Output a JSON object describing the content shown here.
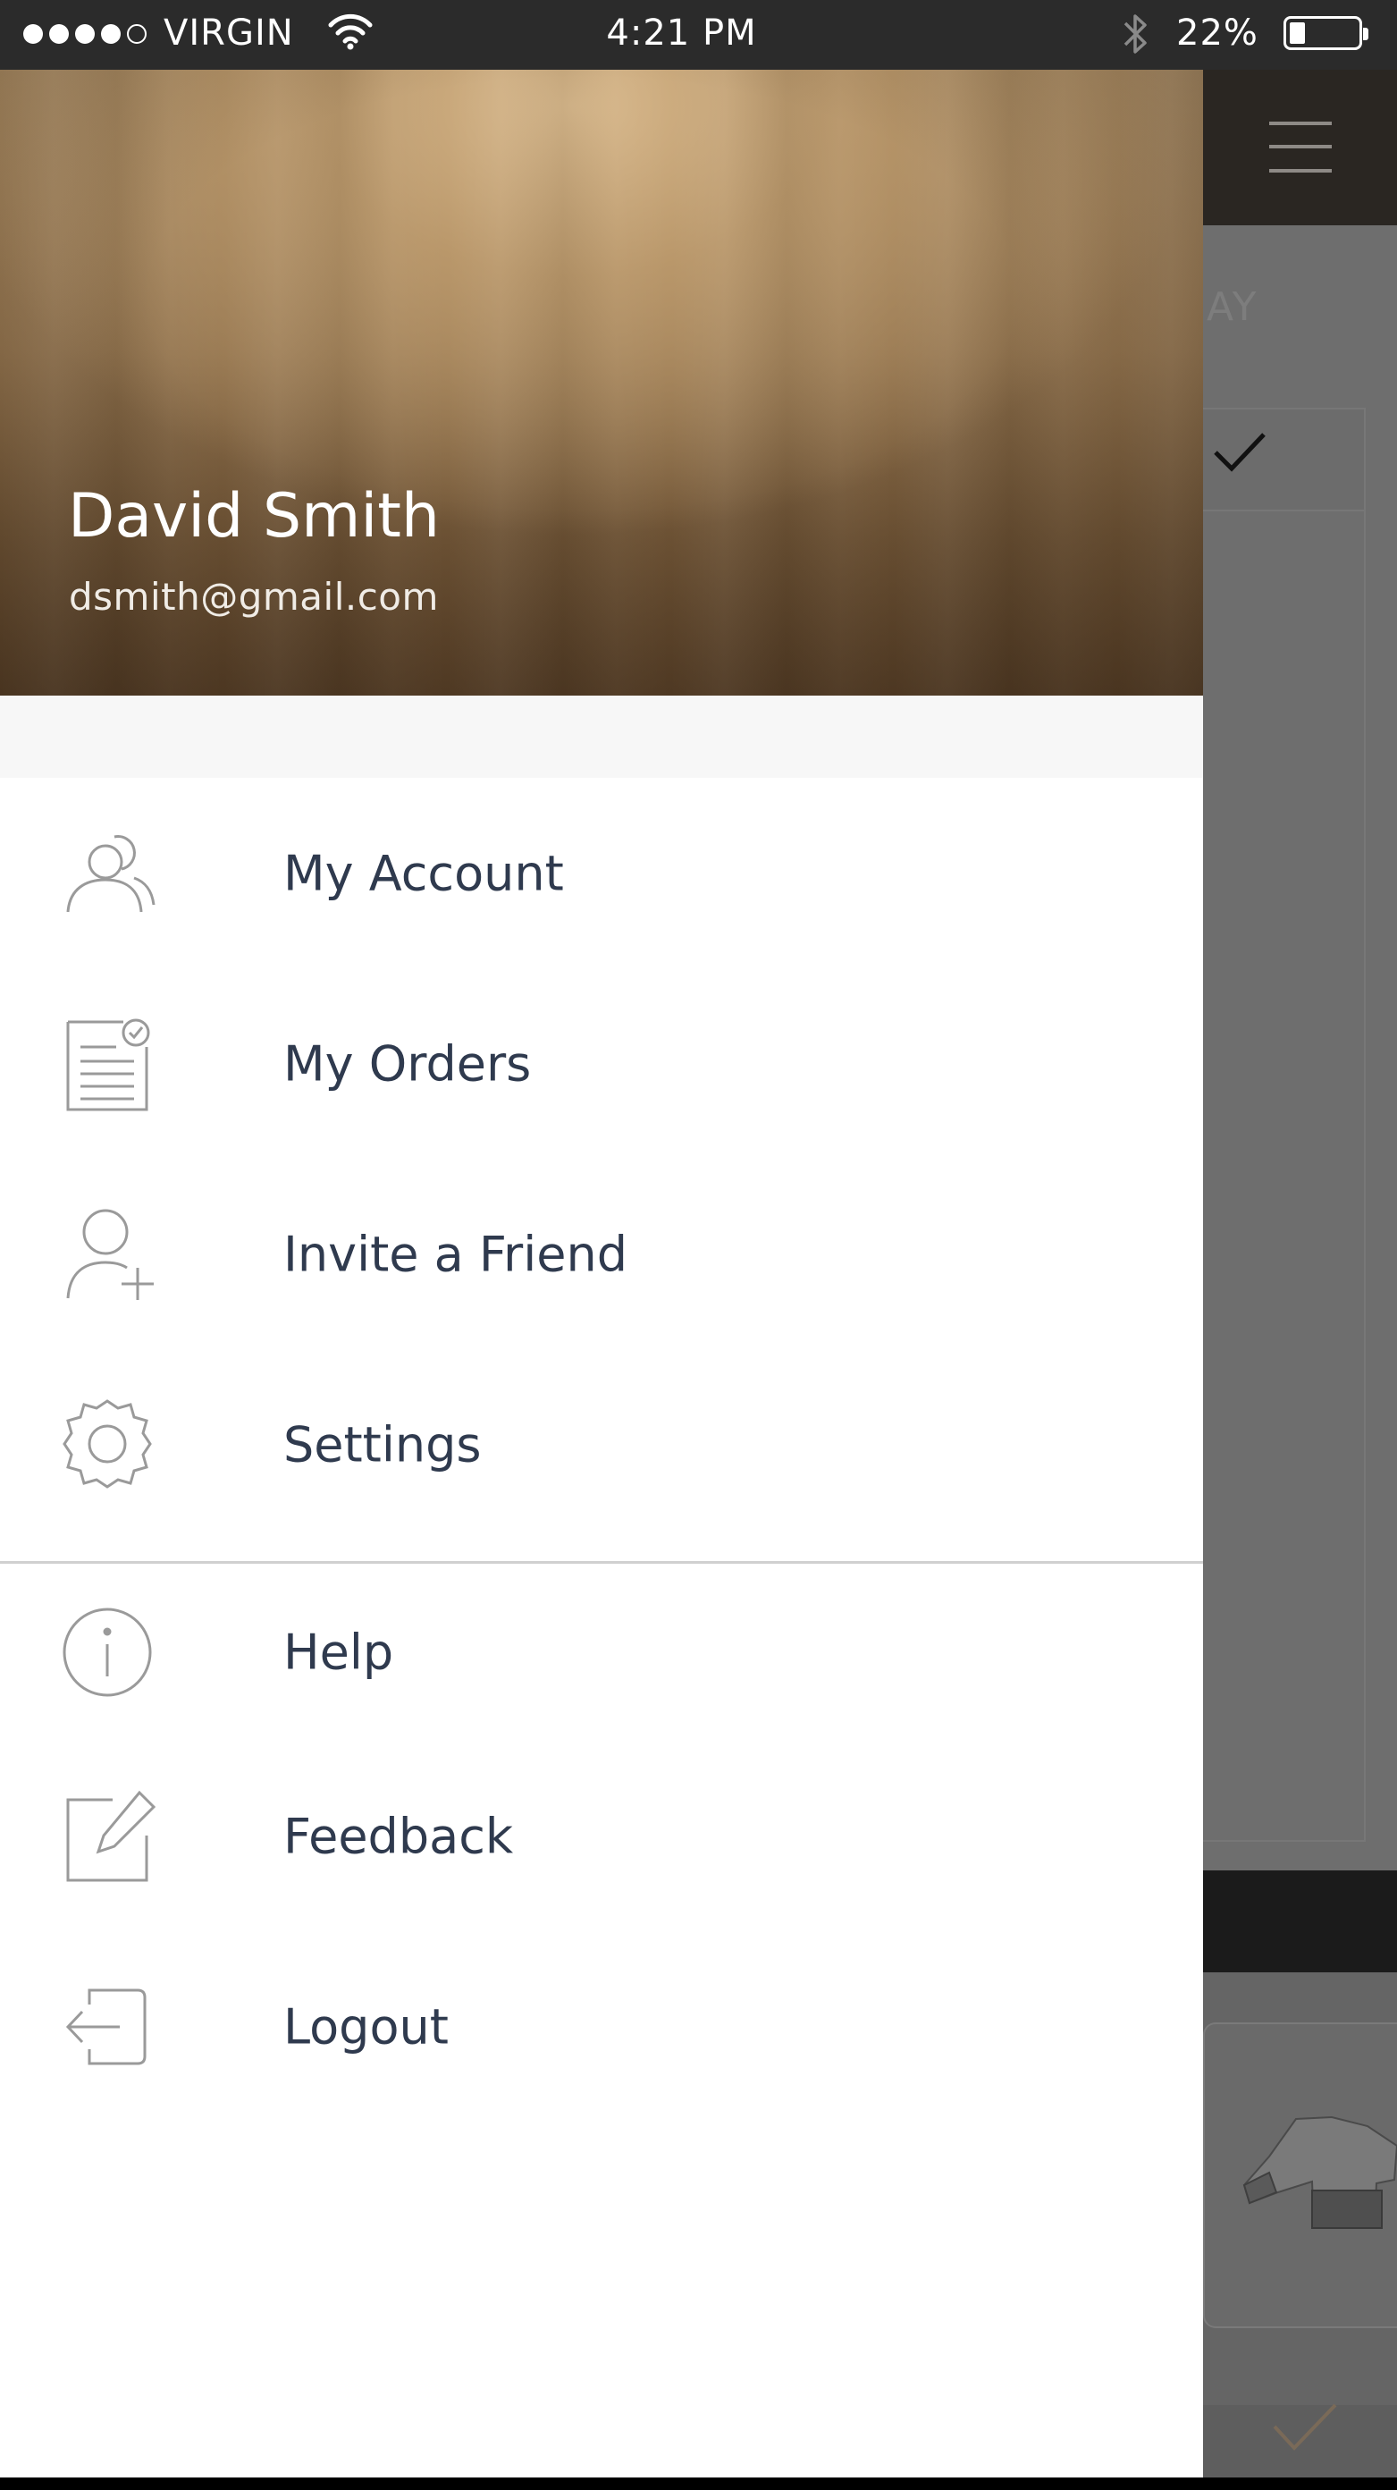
{
  "status_bar": {
    "carrier": "VIRGIN",
    "time": "4:21 PM",
    "battery_percent": "22%",
    "battery_level": 0.22,
    "signal_bars_filled": 4,
    "signal_bars_total": 5
  },
  "profile": {
    "name": "David Smith",
    "email": "dsmith@gmail.com"
  },
  "menu": {
    "primary": [
      {
        "label": "My Account",
        "icon": "user-group-icon"
      },
      {
        "label": "My Orders",
        "icon": "orders-document-icon"
      },
      {
        "label": "Invite a Friend",
        "icon": "add-user-icon"
      },
      {
        "label": "Settings",
        "icon": "gear-icon"
      }
    ],
    "secondary": [
      {
        "label": "Help",
        "icon": "info-icon"
      },
      {
        "label": "Feedback",
        "icon": "edit-icon"
      },
      {
        "label": "Logout",
        "icon": "logout-icon"
      }
    ]
  },
  "background": {
    "label_fragment": "AY"
  },
  "colors": {
    "menu_text": "#2f3a4e",
    "icon_stroke": "#9a9a9a",
    "status_bar": "#2b2b2b",
    "overlay": "#686868"
  }
}
